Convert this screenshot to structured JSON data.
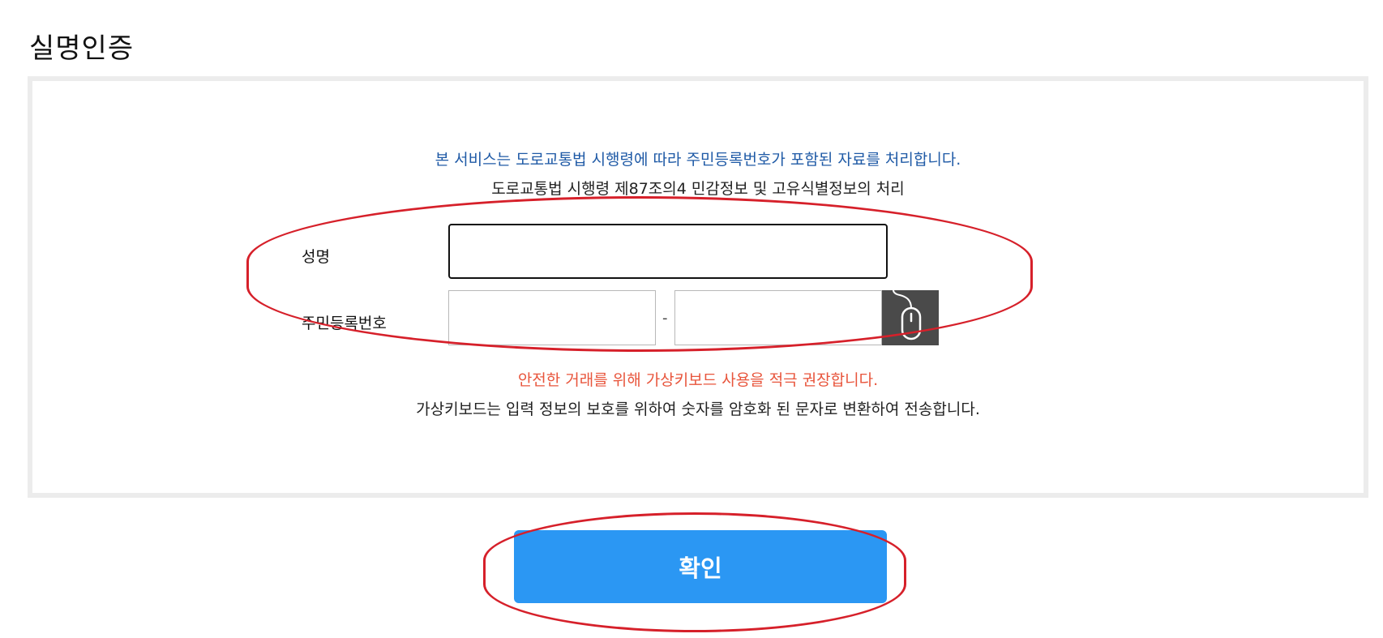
{
  "page": {
    "title": "실명인증"
  },
  "notice": {
    "service_text": "본 서비스는 도로교통법 시행령에 따라 주민등록번호가 포함된 자료를 처리합니다.",
    "law_text": "도로교통법 시행령 제87조의4 민감정보 및 고유식별정보의 처리"
  },
  "form": {
    "name_label": "성명",
    "name_value": "",
    "rrn_label": "주민등록번호",
    "rrn_front_value": "",
    "rrn_separator": "-",
    "rrn_back_value": "",
    "keypad_icon": "mouse-icon"
  },
  "security": {
    "recommend_text": "안전한 거래를 위해 가상키보드 사용을 적극 권장합니다.",
    "explain_text": "가상키보드는 입력 정보의 보호를 위하여 숫자를 암호화 된 문자로 변환하여 전송합니다."
  },
  "actions": {
    "confirm_label": "확인"
  },
  "colors": {
    "notice_blue": "#1f5aa6",
    "warning_red": "#e8553c",
    "confirm_button": "#2b97f3",
    "annotation_red": "#d6202a",
    "keypad_button": "#4a4a4a"
  }
}
